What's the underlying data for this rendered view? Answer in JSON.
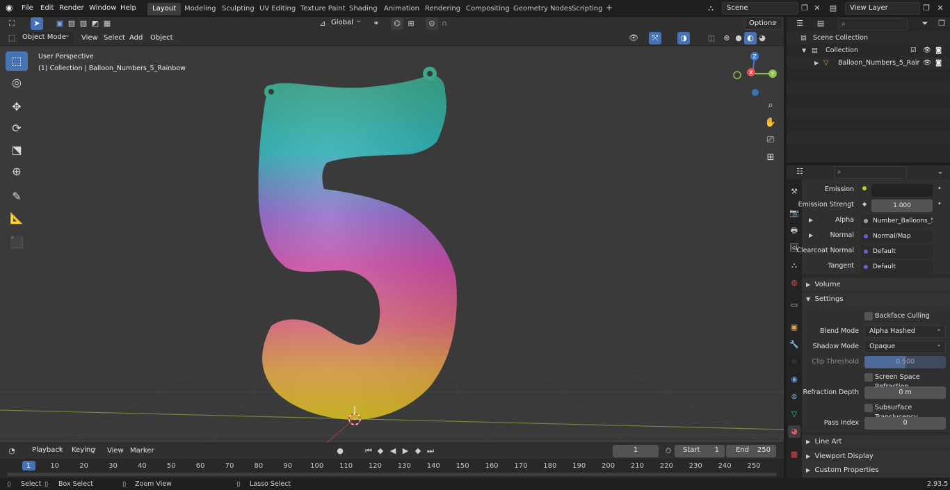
{
  "menus": [
    "File",
    "Edit",
    "Render",
    "Window",
    "Help"
  ],
  "workspaces": [
    "Layout",
    "Modeling",
    "Sculpting",
    "UV Editing",
    "Texture Paint",
    "Shading",
    "Animation",
    "Rendering",
    "Compositing",
    "Geometry Nodes",
    "Scripting"
  ],
  "active_workspace": "Layout",
  "scene": "Scene",
  "view_layer": "View Layer",
  "toolbar": {
    "transform_orientation": "Global",
    "options": "Options"
  },
  "viewport_header": {
    "mode": "Object Mode",
    "menus": [
      "View",
      "Select",
      "Add",
      "Object"
    ]
  },
  "viewport": {
    "perspective": "User Perspective",
    "info": "(1) Collection | Balloon_Numbers_5_Rainbow"
  },
  "gizmo": {
    "x": "X",
    "y": "Y",
    "z": "Z"
  },
  "outliner": {
    "scene_collection": "Scene Collection",
    "collection": "Collection",
    "object": "Balloon_Numbers_5_Rair"
  },
  "properties": {
    "emission_label": "Emission",
    "emission_strength_label": "Emission Strengt",
    "emission_strength_value": "1.000",
    "alpha_label": "Alpha",
    "alpha_value": "Number_Balloons_5...",
    "normal_label": "Normal",
    "normal_value": "Normal/Map",
    "clearcoat_normal_label": "Clearcoat Normal",
    "clearcoat_normal_value": "Default",
    "tangent_label": "Tangent",
    "tangent_value": "Default",
    "volume": "Volume",
    "settings": "Settings",
    "backface_culling": "Backface Culling",
    "blend_mode_label": "Blend Mode",
    "blend_mode_value": "Alpha Hashed",
    "shadow_mode_label": "Shadow Mode",
    "shadow_mode_value": "Opaque",
    "clip_threshold_label": "Clip Threshold",
    "clip_threshold_value": "0.500",
    "ssr": "Screen Space Refraction",
    "refraction_depth_label": "Refraction Depth",
    "refraction_depth_value": "0 m",
    "subsurface": "Subsurface Translucency",
    "pass_index_label": "Pass Index",
    "pass_index_value": "0",
    "line_art": "Line Art",
    "viewport_display": "Viewport Display",
    "custom_properties": "Custom Properties"
  },
  "timeline": {
    "menus": [
      "Playback",
      "Keying",
      "View",
      "Marker"
    ],
    "current_frame": "1",
    "start_label": "Start",
    "start": "1",
    "end_label": "End",
    "end": "250",
    "ruler": [
      "1",
      "10",
      "20",
      "30",
      "40",
      "50",
      "60",
      "70",
      "80",
      "90",
      "100",
      "110",
      "120",
      "130",
      "140",
      "150",
      "160",
      "170",
      "180",
      "190",
      "200",
      "210",
      "220",
      "230",
      "240",
      "250"
    ]
  },
  "status": {
    "select": "Select",
    "box_select": "Box Select",
    "zoom_view": "Zoom View",
    "lasso_select": "Lasso Select",
    "version": "2.93.5"
  },
  "colors": {
    "accent": "#4772b3",
    "x_axis": "#e34d52",
    "y_axis": "#8bc34a",
    "z_axis": "#3f7ad6"
  }
}
